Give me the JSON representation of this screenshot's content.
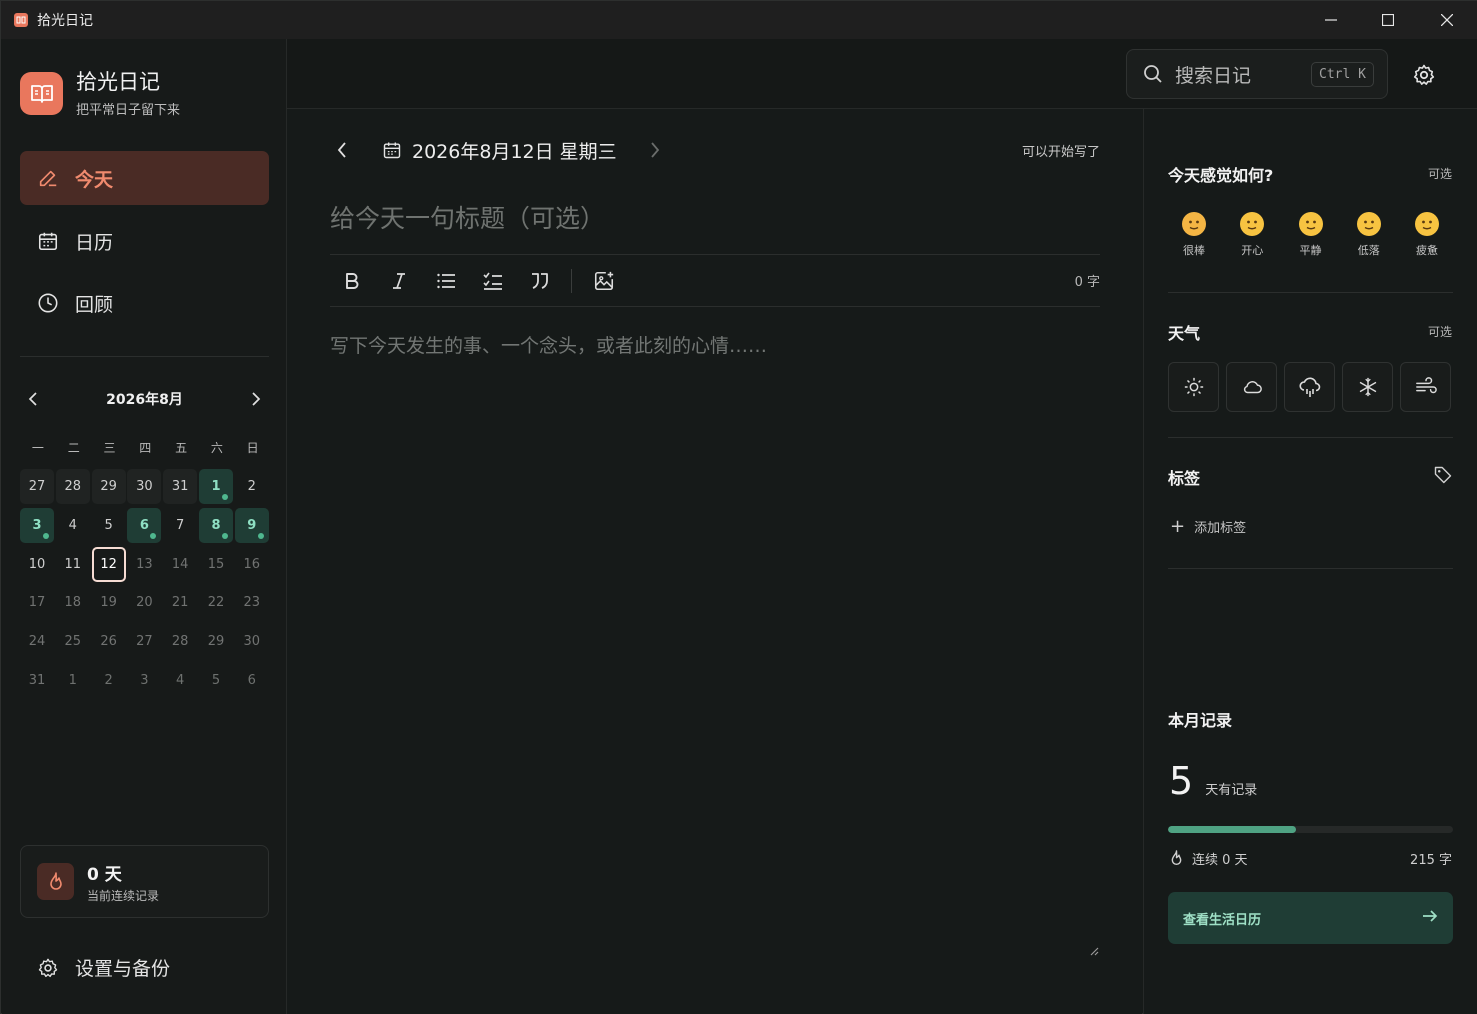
{
  "window": {
    "title": "拾光日记"
  },
  "brand": {
    "title": "拾光日记",
    "subtitle": "把平常日子留下来"
  },
  "nav": {
    "items": [
      {
        "label": "今天"
      },
      {
        "label": "日历"
      },
      {
        "label": "回顾"
      }
    ]
  },
  "mini_calendar": {
    "month": "2026年8月",
    "weekdays": [
      "一",
      "二",
      "三",
      "四",
      "五",
      "六",
      "日"
    ],
    "days": [
      {
        "d": "27",
        "s": "past"
      },
      {
        "d": "28",
        "s": "past"
      },
      {
        "d": "29",
        "s": "past"
      },
      {
        "d": "30",
        "s": "past"
      },
      {
        "d": "31",
        "s": "past"
      },
      {
        "d": "1",
        "s": "entry"
      },
      {
        "d": "2",
        "s": "normal"
      },
      {
        "d": "3",
        "s": "entry"
      },
      {
        "d": "4",
        "s": "normal"
      },
      {
        "d": "5",
        "s": "normal"
      },
      {
        "d": "6",
        "s": "entry"
      },
      {
        "d": "7",
        "s": "normal"
      },
      {
        "d": "8",
        "s": "entry"
      },
      {
        "d": "9",
        "s": "entry"
      },
      {
        "d": "10",
        "s": "normal"
      },
      {
        "d": "11",
        "s": "normal"
      },
      {
        "d": "12",
        "s": "today"
      },
      {
        "d": "13",
        "s": "future"
      },
      {
        "d": "14",
        "s": "future"
      },
      {
        "d": "15",
        "s": "future"
      },
      {
        "d": "16",
        "s": "future"
      },
      {
        "d": "17",
        "s": "future"
      },
      {
        "d": "18",
        "s": "future"
      },
      {
        "d": "19",
        "s": "future"
      },
      {
        "d": "20",
        "s": "future"
      },
      {
        "d": "21",
        "s": "future"
      },
      {
        "d": "22",
        "s": "future"
      },
      {
        "d": "23",
        "s": "future"
      },
      {
        "d": "24",
        "s": "future"
      },
      {
        "d": "25",
        "s": "future"
      },
      {
        "d": "26",
        "s": "future"
      },
      {
        "d": "27",
        "s": "future"
      },
      {
        "d": "28",
        "s": "future"
      },
      {
        "d": "29",
        "s": "future"
      },
      {
        "d": "30",
        "s": "future"
      },
      {
        "d": "31",
        "s": "future"
      },
      {
        "d": "1",
        "s": "muted"
      },
      {
        "d": "2",
        "s": "muted"
      },
      {
        "d": "3",
        "s": "muted"
      },
      {
        "d": "4",
        "s": "muted"
      },
      {
        "d": "5",
        "s": "muted"
      },
      {
        "d": "6",
        "s": "muted"
      }
    ]
  },
  "streak_card": {
    "value": "0 天",
    "label": "当前连续记录"
  },
  "settings_link": {
    "label": "设置与备份"
  },
  "search": {
    "placeholder": "搜索日记",
    "shortcut": "Ctrl K"
  },
  "editor": {
    "date": "2026年8月12日 星期三",
    "status": "可以开始写了",
    "title_placeholder": "给今天一句标题（可选）",
    "body_placeholder": "写下今天发生的事、一个念头，或者此刻的心情……",
    "word_count": "0 字",
    "toolbar": [
      "bold-icon",
      "italic-icon",
      "bullet-list-icon",
      "checklist-icon",
      "quote-icon",
      "insert-image-icon"
    ]
  },
  "right_panel": {
    "mood": {
      "title": "今天感觉如何?",
      "optional": "可选",
      "options": [
        {
          "label": "很棒"
        },
        {
          "label": "开心"
        },
        {
          "label": "平静"
        },
        {
          "label": "低落"
        },
        {
          "label": "疲惫"
        }
      ]
    },
    "weather": {
      "title": "天气",
      "optional": "可选",
      "options": [
        "sun-icon",
        "cloud-icon",
        "rain-icon",
        "snow-icon",
        "wind-icon"
      ]
    },
    "tags": {
      "title": "标签",
      "add_label": "添加标签"
    },
    "month_stats": {
      "title": "本月记录",
      "days": "5",
      "days_label": "天有记录",
      "progress_fraction": 0.45,
      "streak": "连续 0 天",
      "words": "215 字",
      "cta": "查看生活日历"
    }
  },
  "colors": {
    "accent": "#e9775d",
    "accent_bg": "#4a2b25",
    "green": "#4fa383",
    "green_bg": "#1f3d35"
  }
}
